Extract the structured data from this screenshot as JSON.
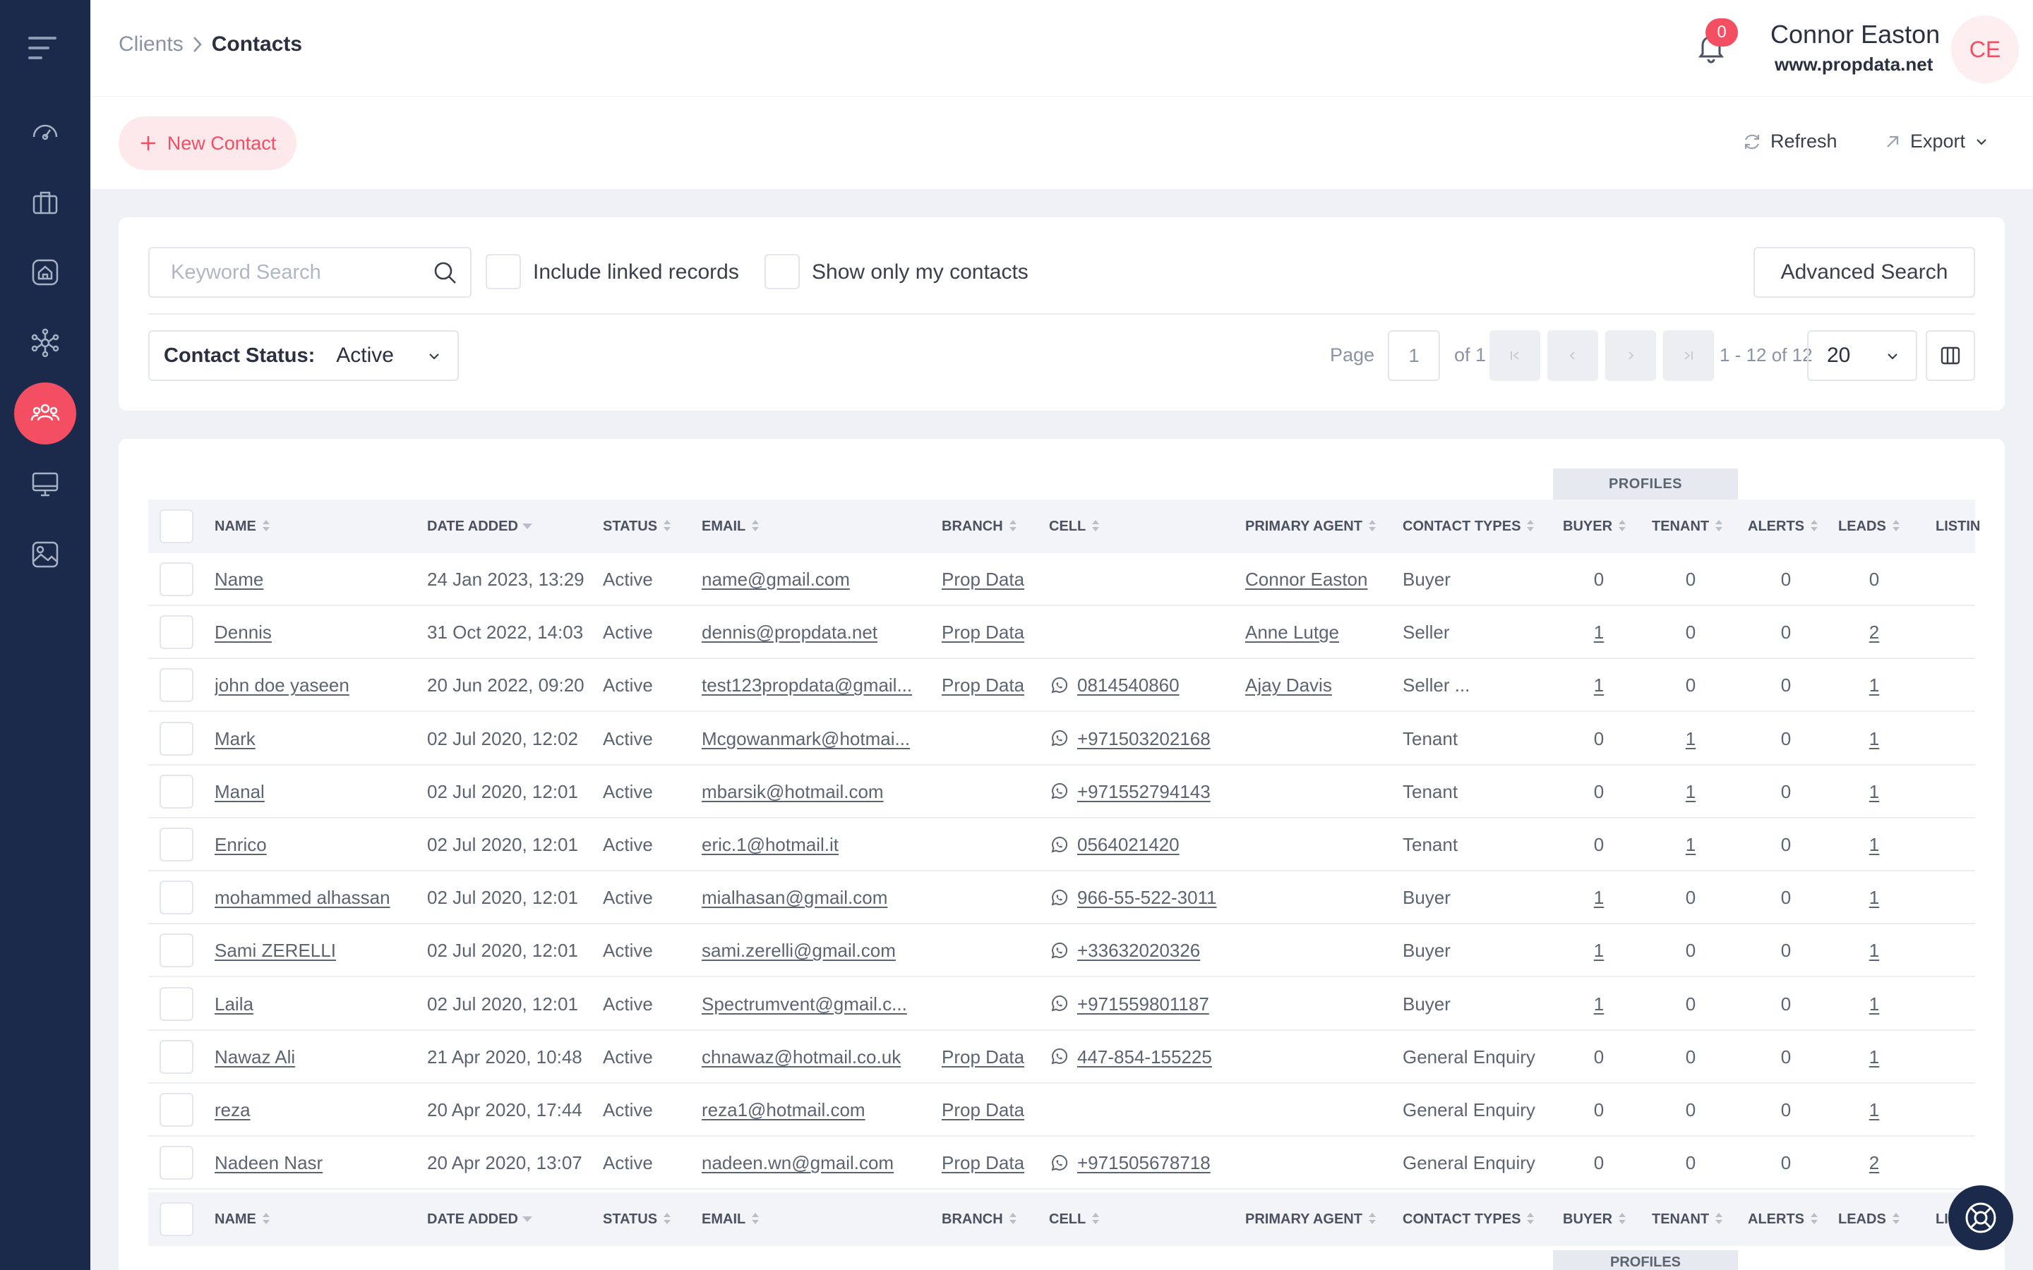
{
  "header": {
    "breadcrumb_parent": "Clients",
    "breadcrumb_current": "Contacts",
    "notification_count": "0",
    "user_name": "Connor Easton",
    "user_site": "www.propdata.net",
    "avatar_initials": "CE"
  },
  "toolbar": {
    "new_contact_label": "New Contact",
    "refresh_label": "Refresh",
    "export_label": "Export"
  },
  "filters": {
    "search_placeholder": "Keyword Search",
    "include_linked_label": "Include linked records",
    "only_mine_label": "Show only my contacts",
    "advanced_search_label": "Advanced Search",
    "status_label": "Contact Status:",
    "status_value": "Active"
  },
  "pagination": {
    "page_label": "Page",
    "page_value": "1",
    "of_label": "of 1",
    "range_label": "1 - 12 of 12",
    "per_page": "20"
  },
  "table": {
    "profiles_label": "PROFILES",
    "columns": {
      "name": "NAME",
      "date_added": "DATE ADDED",
      "status": "STATUS",
      "email": "EMAIL",
      "branch": "BRANCH",
      "cell": "CELL",
      "primary_agent": "PRIMARY AGENT",
      "contact_types": "CONTACT TYPES",
      "buyer": "BUYER",
      "tenant": "TENANT",
      "alerts": "ALERTS",
      "leads": "LEADS",
      "listings": "LISTIN",
      "listings_footer": "LI"
    },
    "rows": [
      {
        "name": "Name",
        "date": "24 Jan 2023, 13:29",
        "status": "Active",
        "email": "name@gmail.com",
        "branch": "Prop Data",
        "cell": "",
        "agent": "Connor Easton",
        "types": "Buyer",
        "buyer": "0",
        "tenant": "0",
        "alerts": "0",
        "leads": "0"
      },
      {
        "name": "Dennis",
        "date": "31 Oct 2022, 14:03",
        "status": "Active",
        "email": "dennis@propdata.net",
        "branch": "Prop Data",
        "cell": "",
        "agent": "Anne Lutge",
        "types": "Seller",
        "buyer": "1",
        "tenant": "0",
        "alerts": "0",
        "leads": "2"
      },
      {
        "name": "john doe yaseen",
        "date": "20 Jun 2022, 09:20",
        "status": "Active",
        "email": "test123propdata@gmail...",
        "branch": "Prop Data",
        "cell": "0814540860",
        "agent": "Ajay Davis",
        "types": "Seller ...",
        "buyer": "1",
        "tenant": "0",
        "alerts": "0",
        "leads": "1"
      },
      {
        "name": "Mark",
        "date": "02 Jul 2020, 12:02",
        "status": "Active",
        "email": "Mcgowanmark@hotmai...",
        "branch": "",
        "cell": "+971503202168",
        "agent": "",
        "types": "Tenant",
        "buyer": "0",
        "tenant": "1",
        "alerts": "0",
        "leads": "1"
      },
      {
        "name": "Manal",
        "date": "02 Jul 2020, 12:01",
        "status": "Active",
        "email": "mbarsik@hotmail.com",
        "branch": "",
        "cell": "+971552794143",
        "agent": "",
        "types": "Tenant",
        "buyer": "0",
        "tenant": "1",
        "alerts": "0",
        "leads": "1"
      },
      {
        "name": "Enrico",
        "date": "02 Jul 2020, 12:01",
        "status": "Active",
        "email": "eric.1@hotmail.it",
        "branch": "",
        "cell": "0564021420",
        "agent": "",
        "types": "Tenant",
        "buyer": "0",
        "tenant": "1",
        "alerts": "0",
        "leads": "1"
      },
      {
        "name": "mohammed alhassan",
        "date": "02 Jul 2020, 12:01",
        "status": "Active",
        "email": "mialhasan@gmail.com",
        "branch": "",
        "cell": "966-55-522-3011",
        "agent": "",
        "types": "Buyer",
        "buyer": "1",
        "tenant": "0",
        "alerts": "0",
        "leads": "1"
      },
      {
        "name": "Sami ZERELLI",
        "date": "02 Jul 2020, 12:01",
        "status": "Active",
        "email": "sami.zerelli@gmail.com",
        "branch": "",
        "cell": "+33632020326",
        "agent": "",
        "types": "Buyer",
        "buyer": "1",
        "tenant": "0",
        "alerts": "0",
        "leads": "1"
      },
      {
        "name": "Laila",
        "date": "02 Jul 2020, 12:01",
        "status": "Active",
        "email": "Spectrumvent@gmail.c...",
        "branch": "",
        "cell": "+971559801187",
        "agent": "",
        "types": "Buyer",
        "buyer": "1",
        "tenant": "0",
        "alerts": "0",
        "leads": "1"
      },
      {
        "name": "Nawaz Ali",
        "date": "21 Apr 2020, 10:48",
        "status": "Active",
        "email": "chnawaz@hotmail.co.uk",
        "branch": "Prop Data",
        "cell": "447-854-155225",
        "agent": "",
        "types": "General Enquiry",
        "buyer": "0",
        "tenant": "0",
        "alerts": "0",
        "leads": "1"
      },
      {
        "name": "reza",
        "date": "20 Apr 2020, 17:44",
        "status": "Active",
        "email": "reza1@hotmail.com",
        "branch": "Prop Data",
        "cell": "",
        "agent": "",
        "types": "General Enquiry",
        "buyer": "0",
        "tenant": "0",
        "alerts": "0",
        "leads": "1"
      },
      {
        "name": "Nadeen Nasr",
        "date": "20 Apr 2020, 13:07",
        "status": "Active",
        "email": "nadeen.wn@gmail.com",
        "branch": "Prop Data",
        "cell": "+971505678718",
        "agent": "",
        "types": "General Enquiry",
        "buyer": "0",
        "tenant": "0",
        "alerts": "0",
        "leads": "2"
      }
    ]
  },
  "colors": {
    "sidebar": "#1b2a4a",
    "accent": "#f44e62",
    "online": "#3fc47a"
  }
}
